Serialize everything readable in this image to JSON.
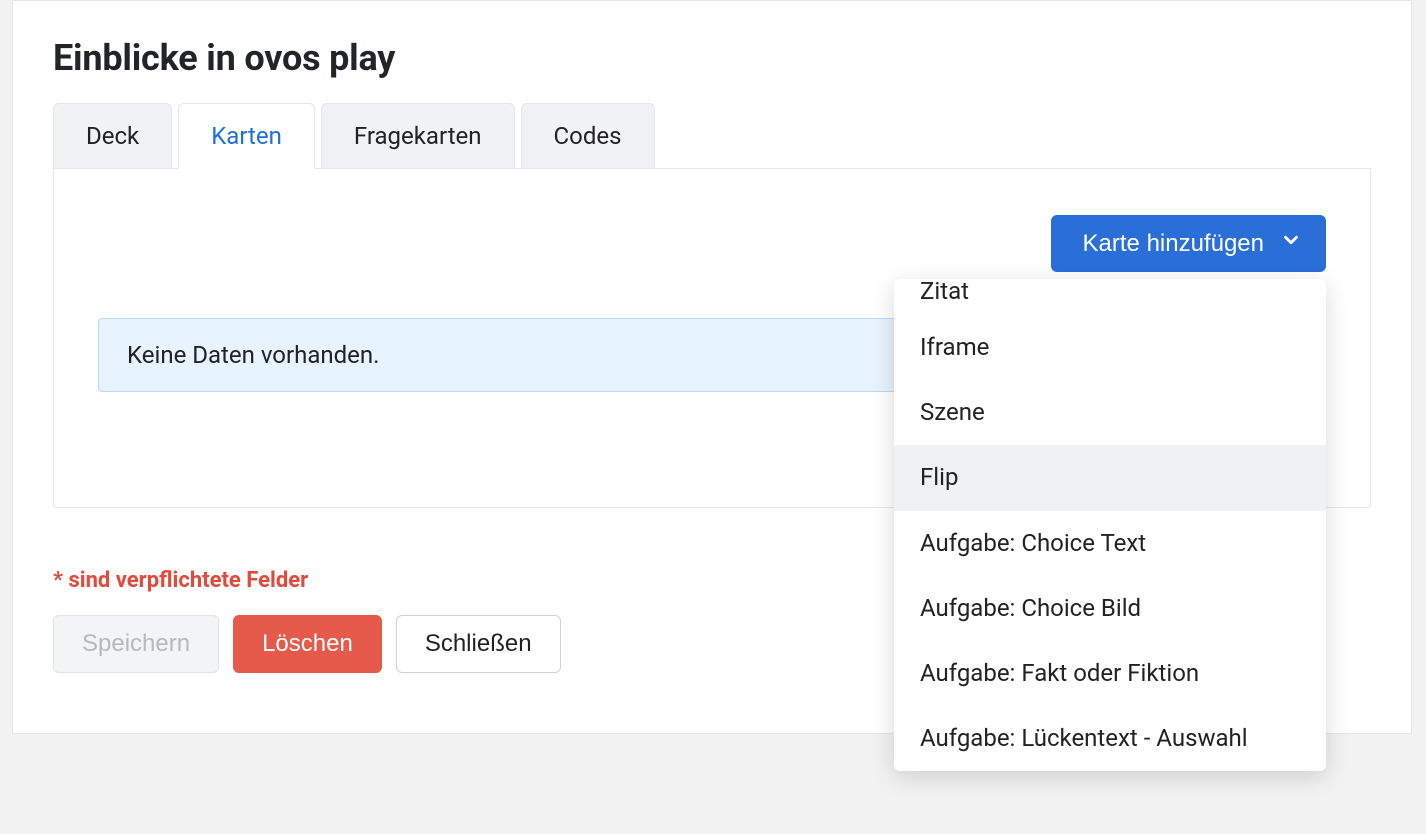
{
  "header": {
    "title": "Einblicke in ovos play"
  },
  "tabs": [
    {
      "label": "Deck"
    },
    {
      "label": "Karten"
    },
    {
      "label": "Fragekarten"
    },
    {
      "label": "Codes"
    }
  ],
  "active_tab_index": 1,
  "toolbar": {
    "add_button_label": "Karte hinzufügen"
  },
  "dropdown": {
    "hover_index": 3,
    "items": [
      {
        "label": "Zitat",
        "partial_top": true
      },
      {
        "label": "Iframe"
      },
      {
        "label": "Szene"
      },
      {
        "label": "Flip"
      },
      {
        "label": "Aufgabe: Choice Text"
      },
      {
        "label": "Aufgabe: Choice Bild"
      },
      {
        "label": "Aufgabe: Fakt oder Fiktion"
      },
      {
        "label": "Aufgabe: Lückentext - Auswahl"
      }
    ]
  },
  "panel": {
    "empty_message": "Keine Daten vorhanden."
  },
  "footer": {
    "required_note": "* sind verpflichtete Felder",
    "save_label": "Speichern",
    "delete_label": "Löschen",
    "close_label": "Schließen"
  }
}
